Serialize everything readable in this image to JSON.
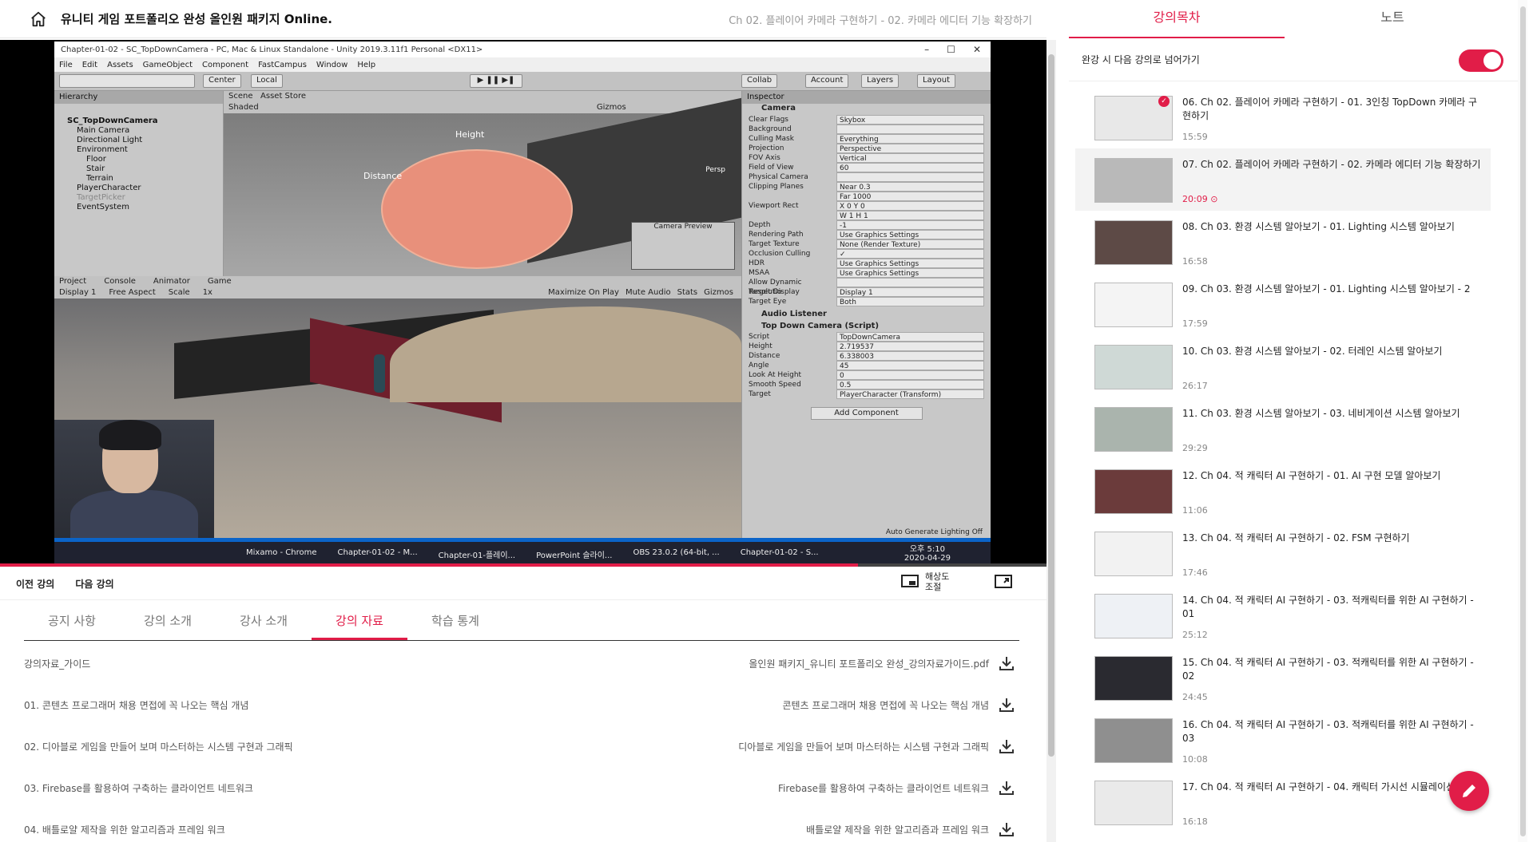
{
  "header": {
    "course_title": "유니티 게임 포트폴리오 완성 올인원 패키지 Online.",
    "chapter_title": "Ch 02. 플레이어 카메라 구현하기 - 02. 카메라 에디터 기능 확장하기"
  },
  "video": {
    "progress": 0.82,
    "unity_window_title": "Chapter-01-02 - SC_TopDownCamera - PC, Mac & Linux Standalone - Unity 2019.3.11f1 Personal <DX11>",
    "unity_menu": [
      "File",
      "Edit",
      "Assets",
      "GameObject",
      "Component",
      "FastCampus",
      "Window",
      "Help"
    ],
    "toolbar": {
      "center": "Center",
      "local": "Local",
      "collab": "Collab",
      "account": "Account",
      "layers": "Layers",
      "layout": "Layout"
    },
    "hierarchy_tab": "Hierarchy",
    "hierarchy_items": [
      "SC_TopDownCamera",
      "Main Camera",
      "Directional Light",
      "Environment",
      "Floor",
      "Stair",
      "Terrain",
      "PlayerCharacter",
      "TargetPicker",
      "EventSystem"
    ],
    "scene_tabs": [
      "Scene",
      "Asset Store"
    ],
    "scene_labels": {
      "shaded": "Shaded",
      "gizmos": "Gizmos",
      "height": "Height",
      "distance": "Distance",
      "persp": "Persp",
      "camera_preview": "Camera Preview"
    },
    "game_tabs": [
      "Project",
      "Console",
      "Animator",
      "Game"
    ],
    "game_bar": {
      "display": "Display 1",
      "aspect": "Free Aspect",
      "scale": "Scale",
      "scale_value": "1x",
      "maximize": "Maximize On Play",
      "mute": "Mute Audio",
      "stats": "Stats",
      "gizmos": "Gizmos"
    },
    "inspector_title": "Inspector",
    "inspector_component": "Camera",
    "inspector_rows": [
      {
        "k": "Clear Flags",
        "v": "Skybox"
      },
      {
        "k": "Background",
        "v": ""
      },
      {
        "k": "Culling Mask",
        "v": "Everything"
      },
      {
        "k": "Projection",
        "v": "Perspective"
      },
      {
        "k": "FOV Axis",
        "v": "Vertical"
      },
      {
        "k": "Field of View",
        "v": "60"
      },
      {
        "k": "Physical Camera",
        "v": ""
      },
      {
        "k": "Clipping Planes",
        "v": "Near 0.3"
      },
      {
        "k": "",
        "v": "Far 1000"
      },
      {
        "k": "Viewport Rect",
        "v": "X 0   Y 0"
      },
      {
        "k": "",
        "v": "W 1   H 1"
      },
      {
        "k": "Depth",
        "v": "-1"
      },
      {
        "k": "Rendering Path",
        "v": "Use Graphics Settings"
      },
      {
        "k": "Target Texture",
        "v": "None (Render Texture)"
      },
      {
        "k": "Occlusion Culling",
        "v": "✓"
      },
      {
        "k": "HDR",
        "v": "Use Graphics Settings"
      },
      {
        "k": "MSAA",
        "v": "Use Graphics Settings"
      },
      {
        "k": "Allow Dynamic Resolutio",
        "v": ""
      },
      {
        "k": "Target Display",
        "v": "Display 1"
      },
      {
        "k": "Target Eye",
        "v": "Both"
      }
    ],
    "inspector_audio": "Audio Listener",
    "inspector_script_title": "Top Down Camera (Script)",
    "inspector_script_rows": [
      {
        "k": "Script",
        "v": "TopDownCamera"
      },
      {
        "k": "Height",
        "v": "2.719537"
      },
      {
        "k": "Distance",
        "v": "6.338003"
      },
      {
        "k": "Angle",
        "v": "45"
      },
      {
        "k": "Look At Height",
        "v": "0"
      },
      {
        "k": "Smooth Speed",
        "v": "0.5"
      },
      {
        "k": "Target",
        "v": "PlayerCharacter (Transform)"
      }
    ],
    "add_component": "Add Component",
    "auto_lighting": "Auto Generate Lighting Off",
    "taskbar_items": [
      "Mixamo - Chrome",
      "Chapter-01-02 - M...",
      "Chapter-01-플레이...",
      "PowerPoint 슬라이...",
      "OBS 23.0.2 (64-bit, ...",
      "Chapter-01-02 - S..."
    ],
    "clock_time": "오후 5:10",
    "clock_date": "2020-04-29"
  },
  "controls": {
    "prev": "이전 강의",
    "next": "다음 강의",
    "resolution": "해상도 조절"
  },
  "tabs": [
    "공지 사항",
    "강의 소개",
    "강사 소개",
    "강의 자료",
    "학습 통계"
  ],
  "active_tab": "강의 자료",
  "materials": [
    {
      "name": "강의자료_가이드",
      "file": "올인원 패키지_유니티 포트폴리오 완성_강의자료가이드.pdf"
    },
    {
      "name": "01. 콘텐츠 프로그래머 채용 면접에 꼭 나오는 핵심 개념",
      "file": "콘텐츠 프로그래머 채용 면접에 꼭 나오는 핵심 개념"
    },
    {
      "name": "02. 디아블로 게임을 만들어 보며 마스터하는 시스템 구현과 그래픽",
      "file": "디아블로 게임을 만들어 보며 마스터하는 시스템 구현과 그래픽"
    },
    {
      "name": "03. Firebase를 활용하여 구축하는 클라이언트 네트워크",
      "file": "Firebase를 활용하여 구축하는 클라이언트 네트워크"
    },
    {
      "name": "04. 배틀로얄 제작을 위한 알고리즘과 프레임 워크",
      "file": "배틀로얄 제작을 위한 알고리즘과 프레임 워크"
    }
  ],
  "sidebar": {
    "tabs": [
      "강의목차",
      "노트"
    ],
    "auto_next": "완강 시 다음 강의로 넘어가기",
    "auto_next_on": true,
    "lectures": [
      {
        "title": "06. Ch 02. 플레이어 카메라 구현하기 - 01. 3인칭 TopDown 카메라 구현하기",
        "duration": "15:59",
        "completed": true
      },
      {
        "title": "07. Ch 02. 플레이어 카메라 구현하기 - 02. 카메라 에디터 기능 확장하기",
        "duration": "20:09",
        "current": true
      },
      {
        "title": "08. Ch 03. 환경 시스템 알아보기 - 01. Lighting 시스템 알아보기",
        "duration": "16:58"
      },
      {
        "title": "09. Ch 03. 환경 시스템 알아보기 - 01. Lighting 시스템 알아보기 - 2",
        "duration": "17:59"
      },
      {
        "title": "10. Ch 03. 환경 시스템 알아보기 - 02. 터레인 시스템 알아보기",
        "duration": "26:17"
      },
      {
        "title": "11. Ch 03. 환경 시스템 알아보기 - 03. 네비게이션 시스템 알아보기",
        "duration": "29:29"
      },
      {
        "title": "12. Ch 04. 적 캐릭터 AI 구현하기 - 01. AI 구현 모델 알아보기",
        "duration": "11:06"
      },
      {
        "title": "13. Ch 04. 적 캐릭터 AI 구현하기 - 02. FSM 구현하기",
        "duration": "17:46"
      },
      {
        "title": "14. Ch 04. 적 캐릭터 AI 구현하기 - 03. 적캐릭터를 위한 AI 구현하기 - 01",
        "duration": "25:12"
      },
      {
        "title": "15. Ch 04. 적 캐릭터 AI 구현하기 - 03. 적캐릭터를 위한 AI 구현하기 - 02",
        "duration": "24:45"
      },
      {
        "title": "16. Ch 04. 적 캐릭터 AI 구현하기 - 03. 적캐릭터를 위한 AI 구현하기 - 03",
        "duration": "10:08"
      },
      {
        "title": "17. Ch 04. 적 캐릭터 AI 구현하기 - 04. 캐릭터 가시선 시뮬레이션 - 01",
        "duration": "16:18"
      }
    ]
  },
  "colors": {
    "accent": "#e11d48",
    "muted": "#888888"
  }
}
